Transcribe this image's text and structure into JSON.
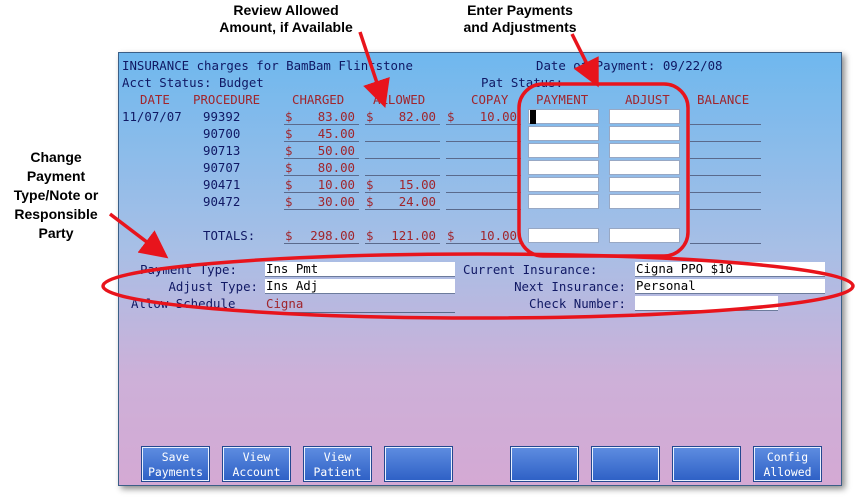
{
  "annotations": {
    "review_allowed": [
      "Review Allowed",
      "Amount, if Available"
    ],
    "enter_payments": [
      "Enter Payments",
      "and Adjustments"
    ],
    "change_payment": [
      "Change",
      "Payment",
      "Type/Note or",
      "Responsible",
      "Party"
    ]
  },
  "header": {
    "title": "INSURANCE charges for BamBam Flintstone",
    "date_of_payment": "Date of Payment: 09/22/08",
    "acct_status": "Acct Status: Budget",
    "pat_status": "Pat Status:"
  },
  "columns": [
    "DATE",
    "PROCEDURE",
    "CHARGED",
    "ALLOWED",
    "COPAY",
    "PAYMENT",
    "ADJUST",
    "BALANCE"
  ],
  "rows": [
    {
      "date": "11/07/07",
      "procedure": "99392",
      "charged": "83.00",
      "allowed": "82.00",
      "copay": "10.00"
    },
    {
      "date": "",
      "procedure": "90700",
      "charged": "45.00",
      "allowed": "",
      "copay": ""
    },
    {
      "date": "",
      "procedure": "90713",
      "charged": "50.00",
      "allowed": "",
      "copay": ""
    },
    {
      "date": "",
      "procedure": "90707",
      "charged": "80.00",
      "allowed": "",
      "copay": ""
    },
    {
      "date": "",
      "procedure": "90471",
      "charged": "10.00",
      "allowed": "15.00",
      "copay": ""
    },
    {
      "date": "",
      "procedure": "90472",
      "charged": "30.00",
      "allowed": "24.00",
      "copay": ""
    }
  ],
  "totals": {
    "label": "TOTALS:",
    "charged": "298.00",
    "allowed": "121.00",
    "copay": "10.00"
  },
  "currency": "$",
  "form": {
    "payment_type_label": "Payment Type:",
    "payment_type": "Ins Pmt",
    "adjust_type_label": "Adjust Type:",
    "adjust_type": "Ins Adj",
    "allow_schedule_label": "Allow Schedule",
    "allow_schedule": "Cigna",
    "current_insurance_label": "Current Insurance:",
    "current_insurance": "Cigna PPO $10",
    "next_insurance_label": "Next Insurance:",
    "next_insurance": "Personal",
    "check_number_label": "Check Number:",
    "check_number": ""
  },
  "buttons": [
    [
      "Save",
      "Payments"
    ],
    [
      "View",
      "Account"
    ],
    [
      "View",
      "Patient"
    ],
    [
      "",
      ""
    ],
    [
      "",
      ""
    ],
    [
      "",
      ""
    ],
    [
      "",
      ""
    ],
    [
      "Config",
      "Allowed"
    ]
  ],
  "colors": {
    "highlight_red": "#e8141c",
    "label_navy": "#101864",
    "value_red": "#a0252c"
  }
}
